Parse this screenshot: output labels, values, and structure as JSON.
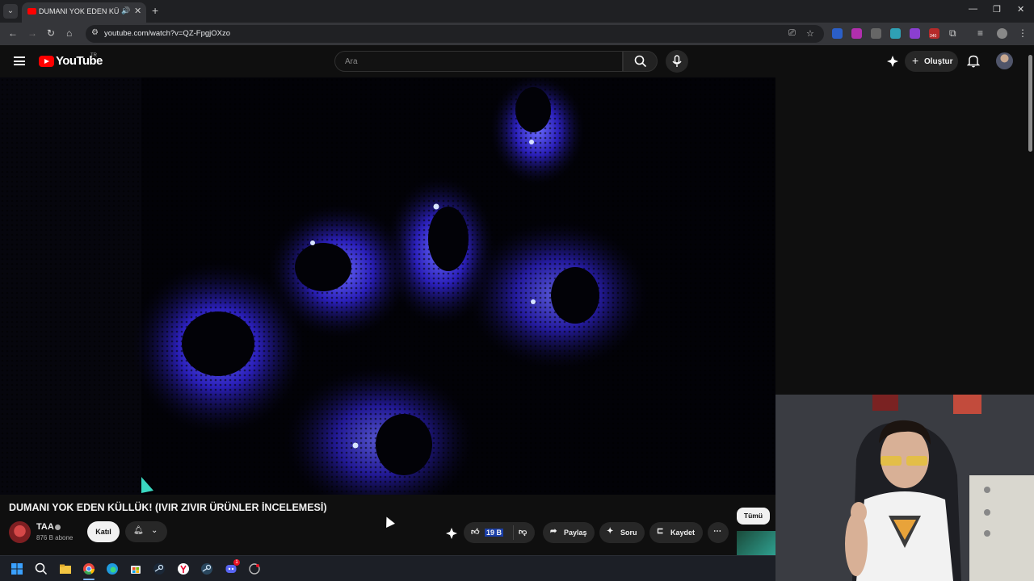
{
  "browser": {
    "tab_title": "DUMANI YOK EDEN KÜLLÜK! (IVIR ZIVIR ÜRÜNLER İNCELEMESİ)",
    "url": "youtube.com/watch?v=QZ-FpgjOXzo",
    "extension_badge": "340"
  },
  "header": {
    "logo_text": "YouTube",
    "country_code": "TR",
    "search_placeholder": "Ara",
    "create_label": "Oluştur"
  },
  "video": {
    "title": "DUMANI YOK EDEN KÜLLÜK! (IVIR ZIVIR ÜRÜNLER İNCELEMESİ)",
    "channel_name": "TAA",
    "subscribers": "876 B abone",
    "join_label": "Katıl",
    "like_count": "19 B",
    "share_label": "Paylaş",
    "ask_label": "Soru",
    "save_label": "Kaydet"
  },
  "sidebar": {
    "chip_all": "Tümü"
  },
  "colors": {
    "brand_red": "#ff0000",
    "bg": "#0f0f0f",
    "pill": "#272727"
  },
  "taskbar": {
    "icons": [
      "windows-start-icon",
      "search-icon",
      "chrome-icon",
      "edge-icon",
      "file-explorer-icon",
      "store-icon",
      "steam-icon",
      "yandex-icon",
      "steam-icon-2",
      "discord-icon",
      "app-icon"
    ],
    "discord_badge": "1"
  }
}
